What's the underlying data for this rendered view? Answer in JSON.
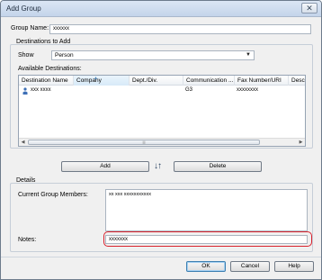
{
  "window": {
    "title": "Add Group",
    "close_symbol": "✕"
  },
  "group_name": {
    "label": "Group Name:",
    "value": "xxxxxx"
  },
  "destinations": {
    "section_label": "Destinations to Add",
    "show_label": "Show",
    "show_value": "Person",
    "available_label": "Available Destinations:",
    "columns": [
      "Destination Name",
      "Company",
      "Dept./Div.",
      "Communication ...",
      "Fax Number/URI",
      "Desc"
    ],
    "rows": [
      {
        "name": "xxx xxxx",
        "company": "",
        "dept": "",
        "communication": "G3",
        "fax": "xxxxxxxx",
        "desc": ""
      }
    ],
    "scroll_left": "◀",
    "scroll_right": "▶",
    "thumb_grip": "|||"
  },
  "actions": {
    "add_label": "Add",
    "delete_label": "Delete",
    "swap_symbol": "↓↑"
  },
  "details": {
    "section_label": "Details",
    "members_label": "Current Group Members:",
    "members_value": "xx xxx   xxxxxxxxxxx",
    "notes_label": "Notes:",
    "notes_value": "xxxxxxx"
  },
  "footer": {
    "ok_label": "OK",
    "cancel_label": "Cancel",
    "help_label": "Help"
  },
  "colors": {
    "highlight_outline": "#d9232e",
    "default_button_border": "#3c7fb1"
  },
  "icons": {
    "person": "person-icon",
    "combo_arrow": "chevron-down-icon",
    "swap": "swap-arrows-icon"
  }
}
